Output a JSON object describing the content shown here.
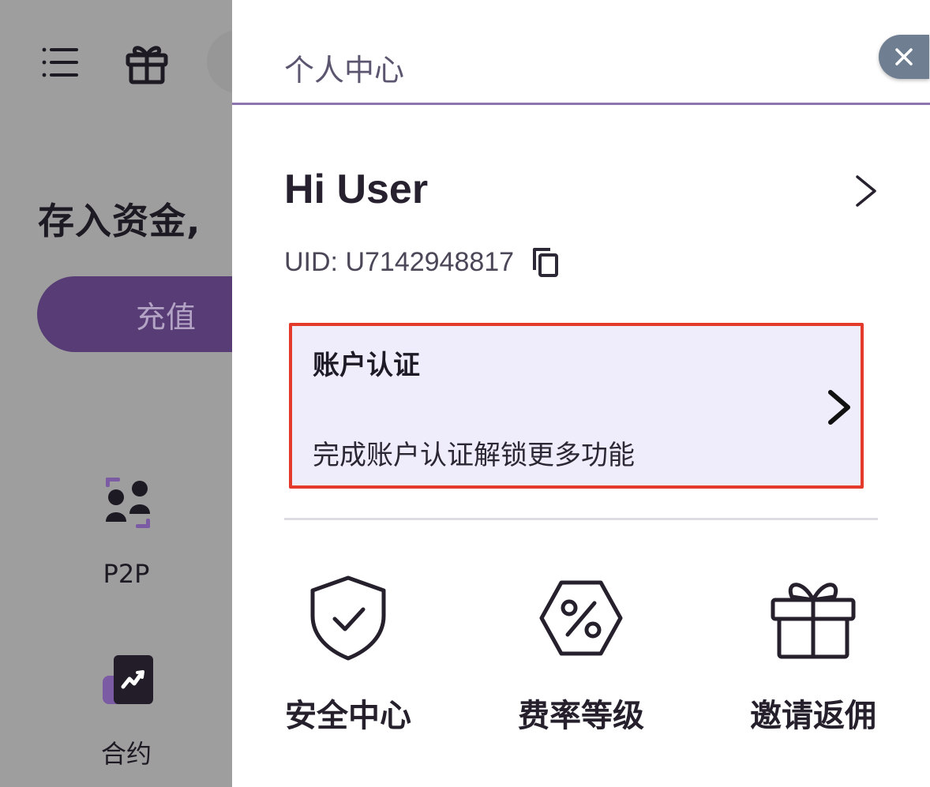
{
  "background": {
    "headline": "存入资金,",
    "deposit_label": "充值",
    "p2p_label": "P2P",
    "contract_label": "合约",
    "icons": [
      "menu-icon",
      "gift-icon",
      "p2p-icon",
      "contract-icon"
    ]
  },
  "drawer": {
    "title": "个人中心",
    "close_icon": "close-icon",
    "greeting": "Hi User",
    "uid": "UID: U7142948817",
    "verification": {
      "title": "账户认证",
      "subtitle": "完成账户认证解锁更多功能"
    },
    "shortcuts": [
      {
        "label": "安全中心",
        "icon": "shield-check-icon"
      },
      {
        "label": "费率等级",
        "icon": "percent-hexagon-icon"
      },
      {
        "label": "邀请返佣",
        "icon": "gift-icon"
      }
    ]
  },
  "colors": {
    "accent": "#573c75",
    "divider_accent": "#8f75b0",
    "card_bg": "#efedfb",
    "highlight_border": "#e43a2c",
    "overlay": "#9e9e9e"
  }
}
